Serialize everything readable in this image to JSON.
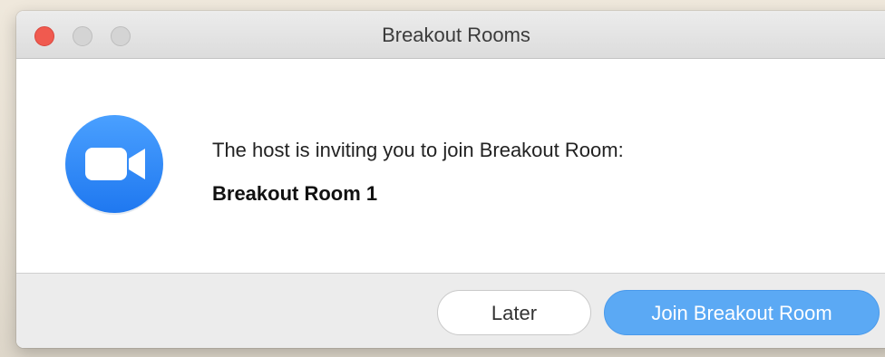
{
  "window": {
    "title": "Breakout Rooms"
  },
  "dialog": {
    "message": "The host is inviting you to join Breakout Room:",
    "room_name": "Breakout Room 1",
    "icon": "zoom-camera-icon"
  },
  "buttons": {
    "later_label": "Later",
    "join_label": "Join Breakout Room"
  },
  "colors": {
    "accent": "#5ba9f4",
    "icon_blue": "#2d8cff",
    "close_red": "#f05a4f"
  }
}
